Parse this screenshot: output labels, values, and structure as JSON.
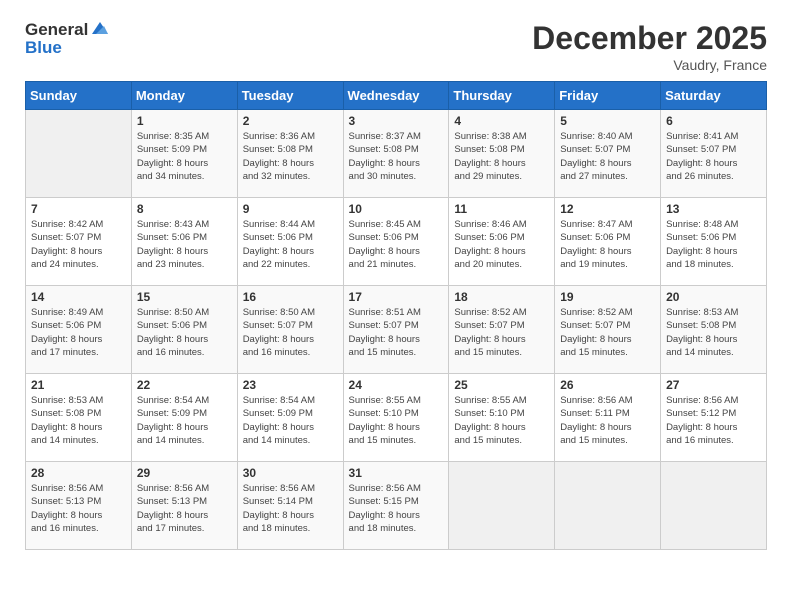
{
  "header": {
    "logo_line1": "General",
    "logo_line2": "Blue",
    "month_year": "December 2025",
    "location": "Vaudry, France"
  },
  "weekdays": [
    "Sunday",
    "Monday",
    "Tuesday",
    "Wednesday",
    "Thursday",
    "Friday",
    "Saturday"
  ],
  "weeks": [
    [
      {
        "day": "",
        "info": ""
      },
      {
        "day": "1",
        "info": "Sunrise: 8:35 AM\nSunset: 5:09 PM\nDaylight: 8 hours\nand 34 minutes."
      },
      {
        "day": "2",
        "info": "Sunrise: 8:36 AM\nSunset: 5:08 PM\nDaylight: 8 hours\nand 32 minutes."
      },
      {
        "day": "3",
        "info": "Sunrise: 8:37 AM\nSunset: 5:08 PM\nDaylight: 8 hours\nand 30 minutes."
      },
      {
        "day": "4",
        "info": "Sunrise: 8:38 AM\nSunset: 5:08 PM\nDaylight: 8 hours\nand 29 minutes."
      },
      {
        "day": "5",
        "info": "Sunrise: 8:40 AM\nSunset: 5:07 PM\nDaylight: 8 hours\nand 27 minutes."
      },
      {
        "day": "6",
        "info": "Sunrise: 8:41 AM\nSunset: 5:07 PM\nDaylight: 8 hours\nand 26 minutes."
      }
    ],
    [
      {
        "day": "7",
        "info": "Sunrise: 8:42 AM\nSunset: 5:07 PM\nDaylight: 8 hours\nand 24 minutes."
      },
      {
        "day": "8",
        "info": "Sunrise: 8:43 AM\nSunset: 5:06 PM\nDaylight: 8 hours\nand 23 minutes."
      },
      {
        "day": "9",
        "info": "Sunrise: 8:44 AM\nSunset: 5:06 PM\nDaylight: 8 hours\nand 22 minutes."
      },
      {
        "day": "10",
        "info": "Sunrise: 8:45 AM\nSunset: 5:06 PM\nDaylight: 8 hours\nand 21 minutes."
      },
      {
        "day": "11",
        "info": "Sunrise: 8:46 AM\nSunset: 5:06 PM\nDaylight: 8 hours\nand 20 minutes."
      },
      {
        "day": "12",
        "info": "Sunrise: 8:47 AM\nSunset: 5:06 PM\nDaylight: 8 hours\nand 19 minutes."
      },
      {
        "day": "13",
        "info": "Sunrise: 8:48 AM\nSunset: 5:06 PM\nDaylight: 8 hours\nand 18 minutes."
      }
    ],
    [
      {
        "day": "14",
        "info": "Sunrise: 8:49 AM\nSunset: 5:06 PM\nDaylight: 8 hours\nand 17 minutes."
      },
      {
        "day": "15",
        "info": "Sunrise: 8:50 AM\nSunset: 5:06 PM\nDaylight: 8 hours\nand 16 minutes."
      },
      {
        "day": "16",
        "info": "Sunrise: 8:50 AM\nSunset: 5:07 PM\nDaylight: 8 hours\nand 16 minutes."
      },
      {
        "day": "17",
        "info": "Sunrise: 8:51 AM\nSunset: 5:07 PM\nDaylight: 8 hours\nand 15 minutes."
      },
      {
        "day": "18",
        "info": "Sunrise: 8:52 AM\nSunset: 5:07 PM\nDaylight: 8 hours\nand 15 minutes."
      },
      {
        "day": "19",
        "info": "Sunrise: 8:52 AM\nSunset: 5:07 PM\nDaylight: 8 hours\nand 15 minutes."
      },
      {
        "day": "20",
        "info": "Sunrise: 8:53 AM\nSunset: 5:08 PM\nDaylight: 8 hours\nand 14 minutes."
      }
    ],
    [
      {
        "day": "21",
        "info": "Sunrise: 8:53 AM\nSunset: 5:08 PM\nDaylight: 8 hours\nand 14 minutes."
      },
      {
        "day": "22",
        "info": "Sunrise: 8:54 AM\nSunset: 5:09 PM\nDaylight: 8 hours\nand 14 minutes."
      },
      {
        "day": "23",
        "info": "Sunrise: 8:54 AM\nSunset: 5:09 PM\nDaylight: 8 hours\nand 14 minutes."
      },
      {
        "day": "24",
        "info": "Sunrise: 8:55 AM\nSunset: 5:10 PM\nDaylight: 8 hours\nand 15 minutes."
      },
      {
        "day": "25",
        "info": "Sunrise: 8:55 AM\nSunset: 5:10 PM\nDaylight: 8 hours\nand 15 minutes."
      },
      {
        "day": "26",
        "info": "Sunrise: 8:56 AM\nSunset: 5:11 PM\nDaylight: 8 hours\nand 15 minutes."
      },
      {
        "day": "27",
        "info": "Sunrise: 8:56 AM\nSunset: 5:12 PM\nDaylight: 8 hours\nand 16 minutes."
      }
    ],
    [
      {
        "day": "28",
        "info": "Sunrise: 8:56 AM\nSunset: 5:13 PM\nDaylight: 8 hours\nand 16 minutes."
      },
      {
        "day": "29",
        "info": "Sunrise: 8:56 AM\nSunset: 5:13 PM\nDaylight: 8 hours\nand 17 minutes."
      },
      {
        "day": "30",
        "info": "Sunrise: 8:56 AM\nSunset: 5:14 PM\nDaylight: 8 hours\nand 18 minutes."
      },
      {
        "day": "31",
        "info": "Sunrise: 8:56 AM\nSunset: 5:15 PM\nDaylight: 8 hours\nand 18 minutes."
      },
      {
        "day": "",
        "info": ""
      },
      {
        "day": "",
        "info": ""
      },
      {
        "day": "",
        "info": ""
      }
    ]
  ]
}
